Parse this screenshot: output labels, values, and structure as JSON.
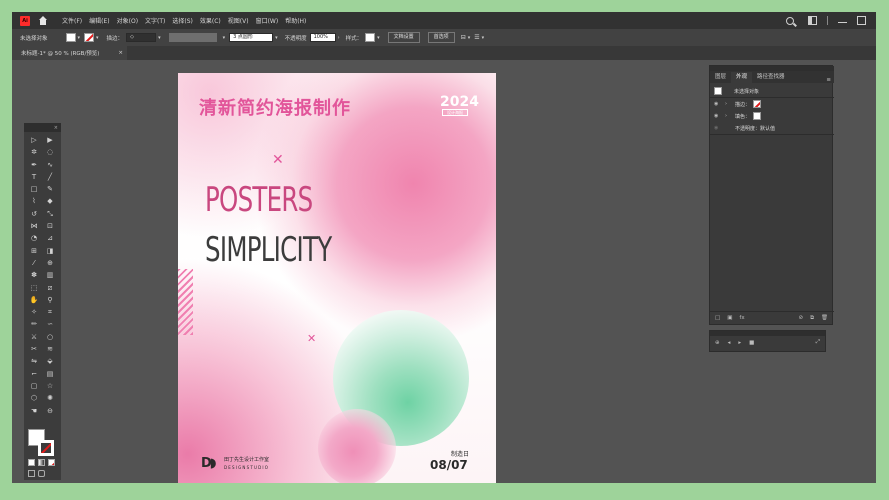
{
  "app": {
    "logo": "Ai"
  },
  "menu": [
    "文件(F)",
    "编辑(E)",
    "对象(O)",
    "文字(T)",
    "选择(S)",
    "效果(C)",
    "视图(V)",
    "窗口(W)",
    "帮助(H)"
  ],
  "control_bar": {
    "selection_label": "未选择对象",
    "stroke_label": "描边：",
    "brush_value": "3 点圆形",
    "opacity_label": "不透明度",
    "opacity_value": "100%",
    "style_label": "样式：",
    "doc_setup_button": "文档设置",
    "prefs_button": "首选项"
  },
  "document_tab": {
    "title": "未标题-1* @ 50 % (RGB/预览)",
    "close": "×"
  },
  "artboard": {
    "title": "清新简约海报制作",
    "year": "2024",
    "year_tag": "设计海报",
    "posters": "POSTERS",
    "simplicity": "SIMPLICITY",
    "logo_mark": "D",
    "studio_cn": "田丁先生设计工作室",
    "studio_en": "DESIGNSTUDIO",
    "made_label": "制造日",
    "made_date": "08/07"
  },
  "panel": {
    "tabs": [
      "图层",
      "外观",
      "路径查找器"
    ],
    "active_tab": "外观",
    "object_label": "未选择对象",
    "stroke_row": "描边：",
    "fill_row": "填色：",
    "opacity_row": "不透明度：默认值"
  },
  "colors": {
    "accent_pink": "#e2559a",
    "mint": "#6ed2a4",
    "frame_green": "#9ed39a"
  }
}
